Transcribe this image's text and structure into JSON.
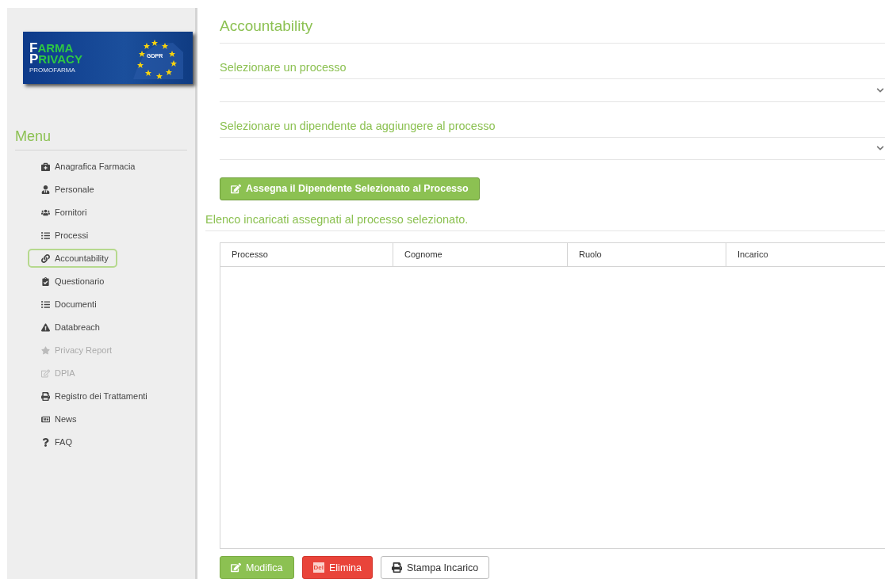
{
  "logo": {
    "line_1_initial": "F",
    "line_1_rest": "ARMA",
    "line_2_initial": "P",
    "line_2_rest": "RIVACY",
    "brand": "PROMOFARMA",
    "badge": "GDPR"
  },
  "menu": {
    "title": "Menu",
    "items": [
      {
        "label": "Anagrafica Farmacia",
        "selected": false,
        "disabled": false
      },
      {
        "label": "Personale",
        "selected": false,
        "disabled": false
      },
      {
        "label": "Fornitori",
        "selected": false,
        "disabled": false
      },
      {
        "label": "Processi",
        "selected": false,
        "disabled": false
      },
      {
        "label": "Accountability",
        "selected": true,
        "disabled": false
      },
      {
        "label": "Questionario",
        "selected": false,
        "disabled": false
      },
      {
        "label": "Documenti",
        "selected": false,
        "disabled": false
      },
      {
        "label": "Databreach",
        "selected": false,
        "disabled": false
      },
      {
        "label": "Privacy Report",
        "selected": false,
        "disabled": true
      },
      {
        "label": "DPIA",
        "selected": false,
        "disabled": true
      },
      {
        "label": "Registro dei Trattamenti",
        "selected": false,
        "disabled": false
      },
      {
        "label": "News",
        "selected": false,
        "disabled": false
      },
      {
        "label": "FAQ",
        "selected": false,
        "disabled": false
      }
    ]
  },
  "page_title": "Accountability",
  "selects": [
    {
      "label": "Selezionare un processo"
    },
    {
      "label": "Selezionare un dipendente da aggiungere al processo"
    }
  ],
  "assign_button": "Assegna il Dipendente Selezionato al Processo",
  "list_title": "Elenco incaricati assegnati al processo selezionato.",
  "table": {
    "columns": [
      "Processo",
      "Cognome",
      "Ruolo",
      "Incarico"
    ]
  },
  "buttons": [
    {
      "kind": "edit",
      "label": "Modifica"
    },
    {
      "kind": "delete",
      "label": "Elimina",
      "icon_text": "Del"
    },
    {
      "kind": "print",
      "label": "Stampa Incarico"
    }
  ]
}
